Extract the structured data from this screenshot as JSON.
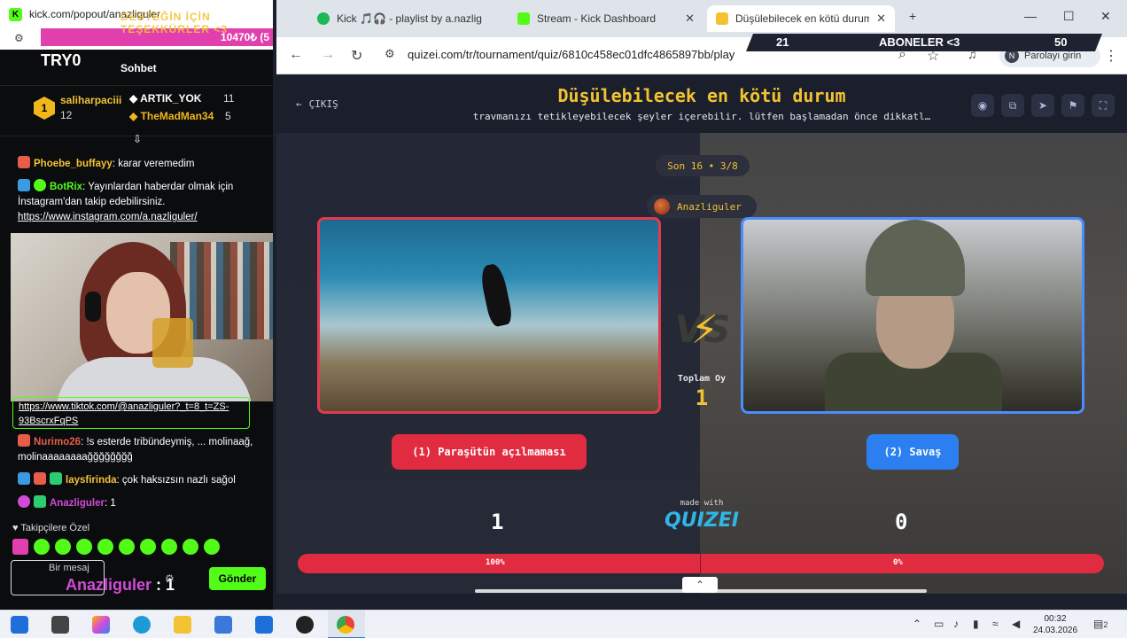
{
  "browser": {
    "tabs": [
      {
        "label": "Kick 🎵🎧 - playlist by a.nazlig",
        "color": "#1db954"
      },
      {
        "label": "Stream - Kick Dashboard",
        "color": "#53fc18"
      },
      {
        "label": "Düşülebilecek en kötü durum -",
        "color": "#f2c233"
      }
    ],
    "new_tab": "+",
    "url": "quizei.com/tr/tournament/quiz/6810c458ec01dfc4865897bb/play",
    "profile_label": "Parolayı girin",
    "profile_initial": "N"
  },
  "sub_overlay": {
    "left": "21",
    "center": "ABONELER <3",
    "right": "50"
  },
  "quiz": {
    "exit_label": "ÇIKIŞ",
    "title": "Düşülebilecek en kötü durum",
    "subtitle": "travmanızı tetikleyebilecek şeyler içerebilir. lütfen başlamadan önce dikkatl…",
    "round_label": "Son 16 • 3/8",
    "host_name": "Anazliguler",
    "total_label": "Toplam Oy",
    "total_value": "1",
    "vs_label": "VS",
    "choice_left": "(1) Paraşütün açılmaması",
    "choice_right": "(2) Savaş",
    "made_with": "made with",
    "brand": "QUIZEI",
    "score_left": "1",
    "score_right": "0",
    "percent_left": "100%",
    "percent_right": "0%",
    "left_fill": 1.0
  },
  "chat": {
    "window_title": "kick.com/popout/anazliguler",
    "donation_text": "10470₺ (5",
    "banner_text": "DESTEĞİN İÇİN TEŞEKKÜRLER <3",
    "channel_label": "TRY0",
    "header": "Sohbet",
    "leaderboard": [
      {
        "rank": "1",
        "name": "saliharpaciii",
        "count": "12",
        "color": "#f2c233"
      },
      {
        "name": "ARTIK_YOK",
        "count": "11",
        "color": "#ffffff"
      },
      {
        "name": "TheMadMan34",
        "count": "5",
        "color": "#f2b61d"
      }
    ],
    "messages": [
      {
        "user": "Phoebe_buffayy",
        "text": "karar veremedim",
        "color": "#f2c233"
      },
      {
        "user": "BotRix",
        "text": "Yayınlardan haberdar olmak için İnstagram'dan takip edebilirsiniz.",
        "link": "https://www.instagram.com/a.nazliguler/",
        "color": "#53fc18"
      },
      {
        "user": "Nurimo26",
        "text": "!s esterde tribündeymiş, ... molinaağ, molinaaaaaaaağğğğğğğğ",
        "color": "#e85c4a"
      },
      {
        "user": "laysfirinda",
        "text": "çok haksızsın nazlı sağol",
        "color": "#f2c233"
      },
      {
        "user": "Anazliguler",
        "text": "1",
        "color": "#d14bd6"
      }
    ],
    "tiktok_link": "https://www.tiktok.com/@anazliguler?_t=8_t=ZS-93BscrxFqPS",
    "followers_label": "Takipçilere Özel",
    "input_placeholder": "Bir mesaj",
    "overlay_name": "Anazliguler",
    "overlay_value": ": 1",
    "send_label": "Gönder"
  },
  "taskbar": {
    "time": "00:32",
    "date": "24.03.2026",
    "notif_count": "2"
  }
}
